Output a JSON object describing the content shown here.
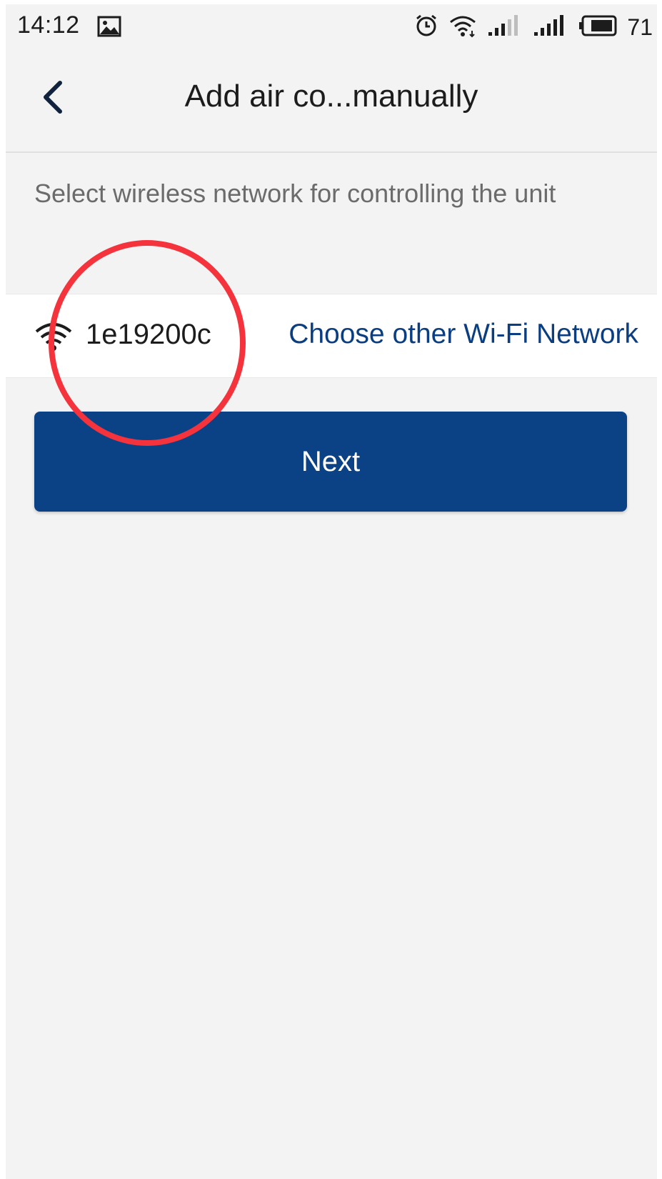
{
  "status_bar": {
    "time": "14:12",
    "battery_percent": "71",
    "icons": [
      "gallery-icon",
      "alarm-icon",
      "wifi-icon",
      "signal-icon",
      "signal-icon",
      "battery-icon"
    ]
  },
  "header": {
    "title": "Add air co...manually",
    "back_icon": "chevron-left-icon"
  },
  "main": {
    "instruction": "Select wireless network for controlling the unit",
    "network": {
      "icon": "wifi-icon",
      "ssid": "1e19200c",
      "choose_other_label": "Choose other Wi-Fi Network"
    },
    "next_label": "Next"
  },
  "colors": {
    "primary": "#0b4285",
    "link": "#0b3e80",
    "background": "#f3f3f3",
    "annotation": "#f5333c"
  }
}
